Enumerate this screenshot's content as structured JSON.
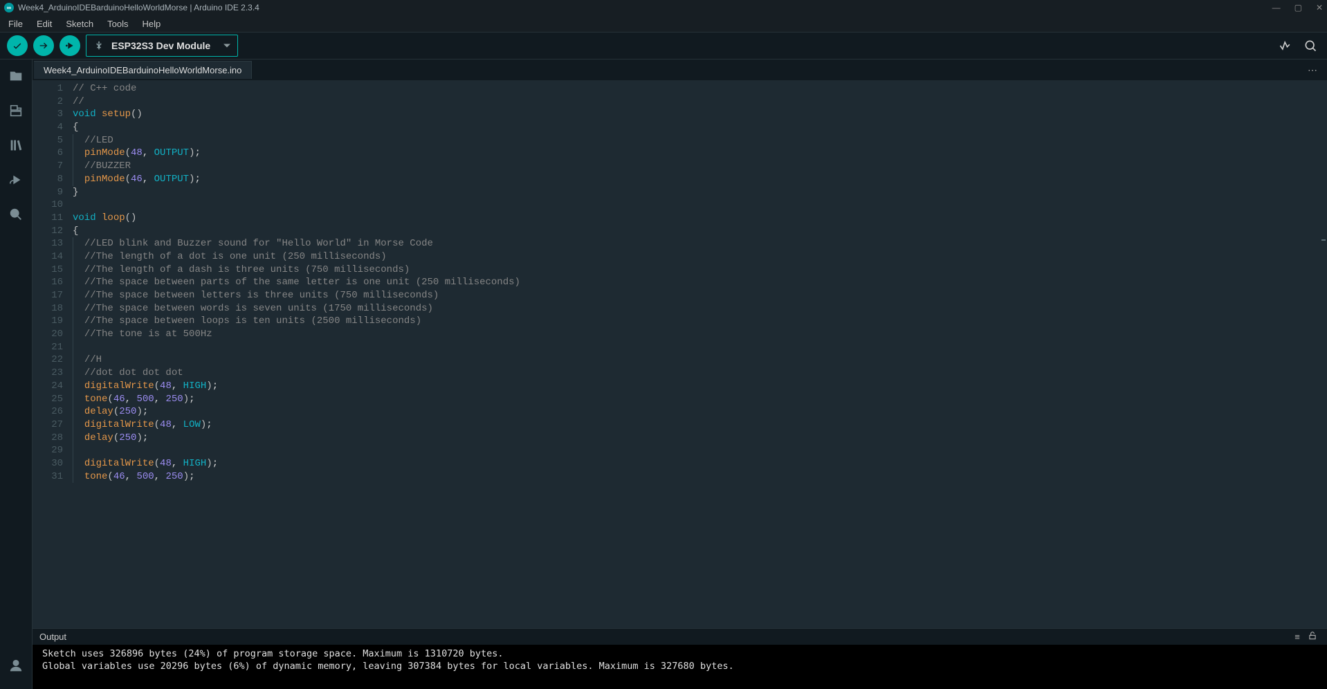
{
  "titlebar": {
    "title": "Week4_ArduinoIDEBarduinoHelloWorldMorse | Arduino IDE 2.3.4"
  },
  "menubar": [
    "File",
    "Edit",
    "Sketch",
    "Tools",
    "Help"
  ],
  "toolbar": {
    "board": "ESP32S3 Dev Module"
  },
  "tab": "Week4_ArduinoIDEBarduinoHelloWorldMorse.ino",
  "code": [
    {
      "n": 1,
      "indent": 0,
      "t": [
        [
          "comment",
          "// C++ code"
        ]
      ]
    },
    {
      "n": 2,
      "indent": 0,
      "t": [
        [
          "comment",
          "//"
        ]
      ]
    },
    {
      "n": 3,
      "indent": 0,
      "t": [
        [
          "keyword",
          "void"
        ],
        [
          "plain",
          " "
        ],
        [
          "func",
          "setup"
        ],
        [
          "paren",
          "()"
        ]
      ]
    },
    {
      "n": 4,
      "indent": 0,
      "t": [
        [
          "brace",
          "{"
        ]
      ]
    },
    {
      "n": 5,
      "indent": 1,
      "t": [
        [
          "comment",
          "//LED"
        ]
      ]
    },
    {
      "n": 6,
      "indent": 1,
      "t": [
        [
          "func",
          "pinMode"
        ],
        [
          "paren",
          "("
        ],
        [
          "num",
          "48"
        ],
        [
          "plain",
          ", "
        ],
        [
          "const",
          "OUTPUT"
        ],
        [
          "paren",
          ")"
        ],
        [
          "plain",
          ";"
        ]
      ]
    },
    {
      "n": 7,
      "indent": 1,
      "t": [
        [
          "comment",
          "//BUZZER"
        ]
      ]
    },
    {
      "n": 8,
      "indent": 1,
      "t": [
        [
          "func",
          "pinMode"
        ],
        [
          "paren",
          "("
        ],
        [
          "num",
          "46"
        ],
        [
          "plain",
          ", "
        ],
        [
          "const",
          "OUTPUT"
        ],
        [
          "paren",
          ")"
        ],
        [
          "plain",
          ";"
        ]
      ]
    },
    {
      "n": 9,
      "indent": 0,
      "t": [
        [
          "brace",
          "}"
        ]
      ]
    },
    {
      "n": 10,
      "indent": 0,
      "t": []
    },
    {
      "n": 11,
      "indent": 0,
      "t": [
        [
          "keyword",
          "void"
        ],
        [
          "plain",
          " "
        ],
        [
          "func",
          "loop"
        ],
        [
          "paren",
          "()"
        ]
      ]
    },
    {
      "n": 12,
      "indent": 0,
      "t": [
        [
          "brace",
          "{"
        ]
      ]
    },
    {
      "n": 13,
      "indent": 1,
      "t": [
        [
          "comment",
          "//LED blink and Buzzer sound for \"Hello World\" in Morse Code"
        ]
      ]
    },
    {
      "n": 14,
      "indent": 1,
      "t": [
        [
          "comment",
          "//The length of a dot is one unit (250 milliseconds)"
        ]
      ]
    },
    {
      "n": 15,
      "indent": 1,
      "t": [
        [
          "comment",
          "//The length of a dash is three units (750 milliseconds)"
        ]
      ]
    },
    {
      "n": 16,
      "indent": 1,
      "t": [
        [
          "comment",
          "//The space between parts of the same letter is one unit (250 milliseconds)"
        ]
      ]
    },
    {
      "n": 17,
      "indent": 1,
      "t": [
        [
          "comment",
          "//The space between letters is three units (750 milliseconds)"
        ]
      ]
    },
    {
      "n": 18,
      "indent": 1,
      "t": [
        [
          "comment",
          "//The space between words is seven units (1750 milliseconds)"
        ]
      ]
    },
    {
      "n": 19,
      "indent": 1,
      "t": [
        [
          "comment",
          "//The space between loops is ten units (2500 milliseconds)"
        ]
      ]
    },
    {
      "n": 20,
      "indent": 1,
      "t": [
        [
          "comment",
          "//The tone is at 500Hz"
        ]
      ]
    },
    {
      "n": 21,
      "indent": 1,
      "t": []
    },
    {
      "n": 22,
      "indent": 1,
      "t": [
        [
          "comment",
          "//H"
        ]
      ]
    },
    {
      "n": 23,
      "indent": 1,
      "t": [
        [
          "comment",
          "//dot dot dot dot"
        ]
      ]
    },
    {
      "n": 24,
      "indent": 1,
      "t": [
        [
          "func",
          "digitalWrite"
        ],
        [
          "paren",
          "("
        ],
        [
          "num",
          "48"
        ],
        [
          "plain",
          ", "
        ],
        [
          "const",
          "HIGH"
        ],
        [
          "paren",
          ")"
        ],
        [
          "plain",
          ";"
        ]
      ]
    },
    {
      "n": 25,
      "indent": 1,
      "t": [
        [
          "func",
          "tone"
        ],
        [
          "paren",
          "("
        ],
        [
          "num",
          "46"
        ],
        [
          "plain",
          ", "
        ],
        [
          "num",
          "500"
        ],
        [
          "plain",
          ", "
        ],
        [
          "num",
          "250"
        ],
        [
          "paren",
          ")"
        ],
        [
          "plain",
          ";"
        ]
      ]
    },
    {
      "n": 26,
      "indent": 1,
      "t": [
        [
          "func",
          "delay"
        ],
        [
          "paren",
          "("
        ],
        [
          "num",
          "250"
        ],
        [
          "paren",
          ")"
        ],
        [
          "plain",
          ";"
        ]
      ]
    },
    {
      "n": 27,
      "indent": 1,
      "t": [
        [
          "func",
          "digitalWrite"
        ],
        [
          "paren",
          "("
        ],
        [
          "num",
          "48"
        ],
        [
          "plain",
          ", "
        ],
        [
          "const",
          "LOW"
        ],
        [
          "paren",
          ")"
        ],
        [
          "plain",
          ";"
        ]
      ]
    },
    {
      "n": 28,
      "indent": 1,
      "t": [
        [
          "func",
          "delay"
        ],
        [
          "paren",
          "("
        ],
        [
          "num",
          "250"
        ],
        [
          "paren",
          ")"
        ],
        [
          "plain",
          ";"
        ]
      ]
    },
    {
      "n": 29,
      "indent": 1,
      "t": []
    },
    {
      "n": 30,
      "indent": 1,
      "t": [
        [
          "func",
          "digitalWrite"
        ],
        [
          "paren",
          "("
        ],
        [
          "num",
          "48"
        ],
        [
          "plain",
          ", "
        ],
        [
          "const",
          "HIGH"
        ],
        [
          "paren",
          ")"
        ],
        [
          "plain",
          ";"
        ]
      ]
    },
    {
      "n": 31,
      "indent": 1,
      "t": [
        [
          "func",
          "tone"
        ],
        [
          "paren",
          "("
        ],
        [
          "num",
          "46"
        ],
        [
          "plain",
          ", "
        ],
        [
          "num",
          "500"
        ],
        [
          "plain",
          ", "
        ],
        [
          "num",
          "250"
        ],
        [
          "paren",
          ")"
        ],
        [
          "plain",
          ";"
        ]
      ]
    }
  ],
  "output_header": "Output",
  "output_lines": [
    "Sketch uses 326896 bytes (24%) of program storage space. Maximum is 1310720 bytes.",
    "Global variables use 20296 bytes (6%) of dynamic memory, leaving 307384 bytes for local variables. Maximum is 327680 bytes."
  ]
}
